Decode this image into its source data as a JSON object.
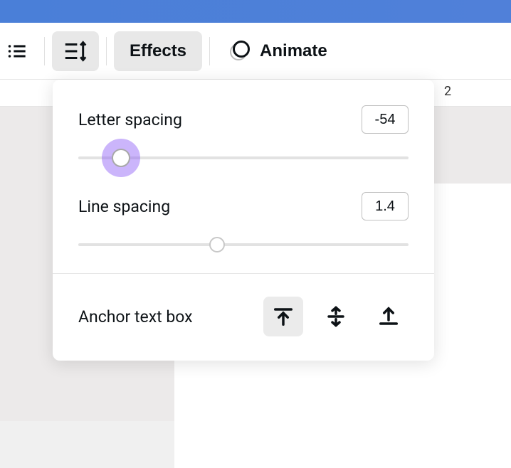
{
  "toolbar": {
    "effects_label": "Effects",
    "animate_label": "Animate"
  },
  "ruler": {
    "tick_2": "2"
  },
  "spacing_panel": {
    "letter_spacing_label": "Letter spacing",
    "letter_spacing_value": "-54",
    "letter_spacing_slider_percent": 13,
    "line_spacing_label": "Line spacing",
    "line_spacing_value": "1.4",
    "line_spacing_slider_percent": 42,
    "anchor_label": "Anchor text box",
    "anchor_selected": "top"
  }
}
